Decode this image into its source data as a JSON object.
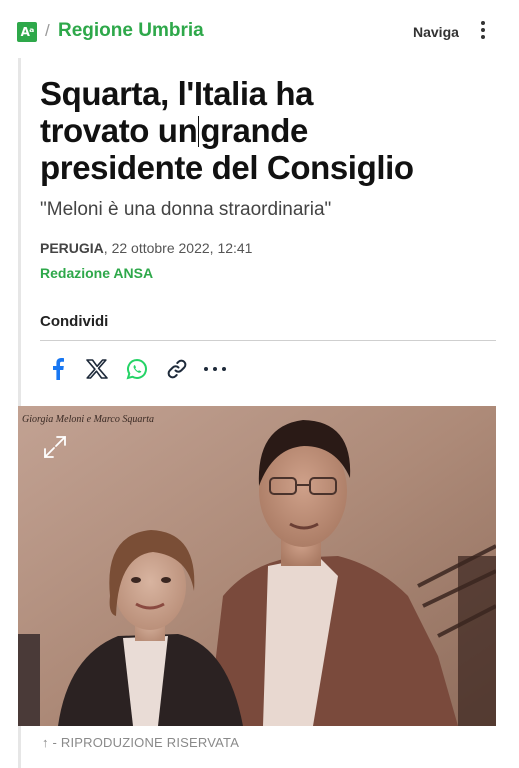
{
  "header": {
    "logo_text": "Aᵃ",
    "separator": "/",
    "section": "Regione Umbria",
    "nav_label": "Naviga"
  },
  "article": {
    "title_line1": "Squarta, l'Italia ha",
    "title_line2": "trovato un",
    "title_line2b": "grande",
    "title_line3": "presidente del Consiglio",
    "subtitle": "\"Meloni è una donna straordinaria\"",
    "location": "PERUGIA",
    "date": ", 22 ottobre 2022, 12:41",
    "author": "Redazione ANSA"
  },
  "share": {
    "label": "Condividi",
    "icons": [
      "facebook-icon",
      "x-icon",
      "whatsapp-icon",
      "link-icon",
      "more-icon"
    ]
  },
  "photo": {
    "inset_caption": "Giorgia Meloni e Marco Squarta"
  },
  "caption": {
    "text": "↑ - RIPRODUZIONE RISERVATA"
  },
  "colors": {
    "accent": "#2ea84a",
    "facebook": "#1877f2",
    "whatsapp": "#25d366"
  }
}
